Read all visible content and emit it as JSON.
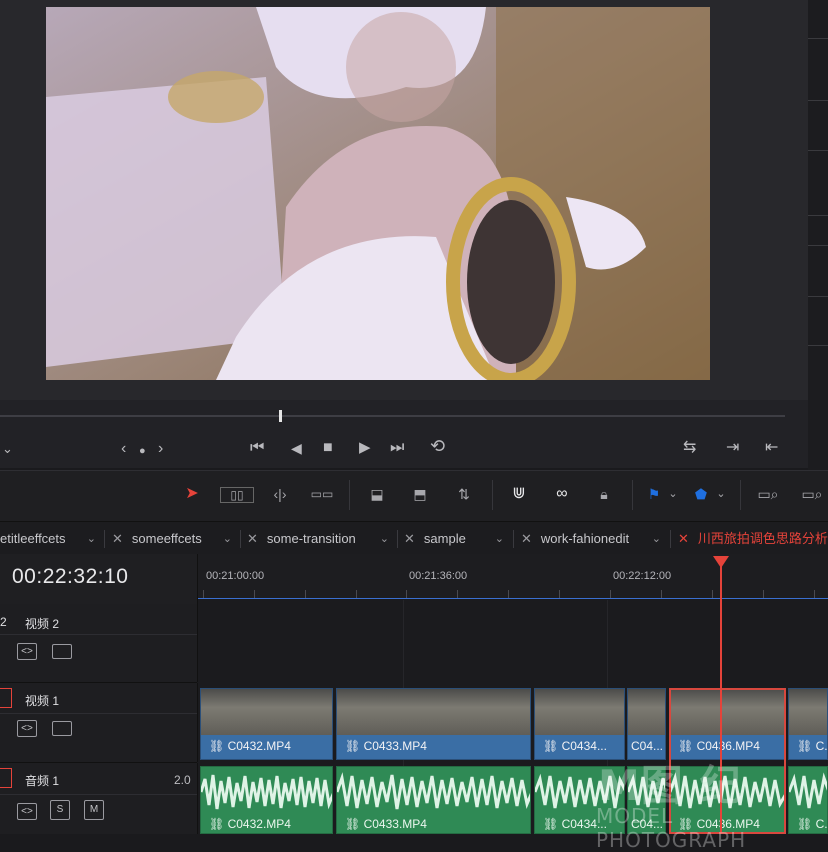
{
  "viewer": {
    "nav_left": "‹",
    "nav_dot": "●",
    "nav_right": "›",
    "transport": {
      "skip_back": "⏮",
      "step_back": "◀",
      "stop": "■",
      "play": "▶",
      "skip_forward": "⏭",
      "loop": "⟲"
    }
  },
  "tabs": [
    {
      "label": "etitleeffcets",
      "has_close": false
    },
    {
      "label": "someeffcets",
      "has_close": true
    },
    {
      "label": "some-transition",
      "has_close": true
    },
    {
      "label": "sample",
      "has_close": true
    },
    {
      "label": "work-fahionedit",
      "has_close": true
    },
    {
      "label": "川西旅拍调色思路分析",
      "has_close": true,
      "active": true,
      "color": "#e5433a"
    }
  ],
  "timeline": {
    "timecode": "00:22:32:10",
    "ruler": [
      "00:21:00:00",
      "00:21:36:00",
      "00:22:12:00"
    ],
    "tracks": [
      {
        "id": "2",
        "name": "视频 2",
        "type": "video"
      },
      {
        "id": "1",
        "name": "视频 1",
        "type": "video"
      },
      {
        "id": "1",
        "name": "音频 1",
        "type": "audio",
        "channel": "2.0",
        "solo": "S",
        "mute": "M"
      }
    ],
    "video_clips": [
      "C0432.MP4",
      "C0433.MP4",
      "C0434...",
      "C04...",
      "C0436.MP4",
      "C..."
    ],
    "audio_clips": [
      "C0432.MP4",
      "C0433.MP4",
      "C0434...",
      "C04...",
      "C0436.MP4",
      "C..."
    ]
  },
  "watermark": {
    "main": "M图 纪",
    "sub": "MODEL PHOTOGRAPH"
  },
  "colors": {
    "accent": "#e5433a",
    "video_clip": "#3a6ea5",
    "audio_clip": "#2f8a55",
    "flag": "#1f6fe0"
  }
}
